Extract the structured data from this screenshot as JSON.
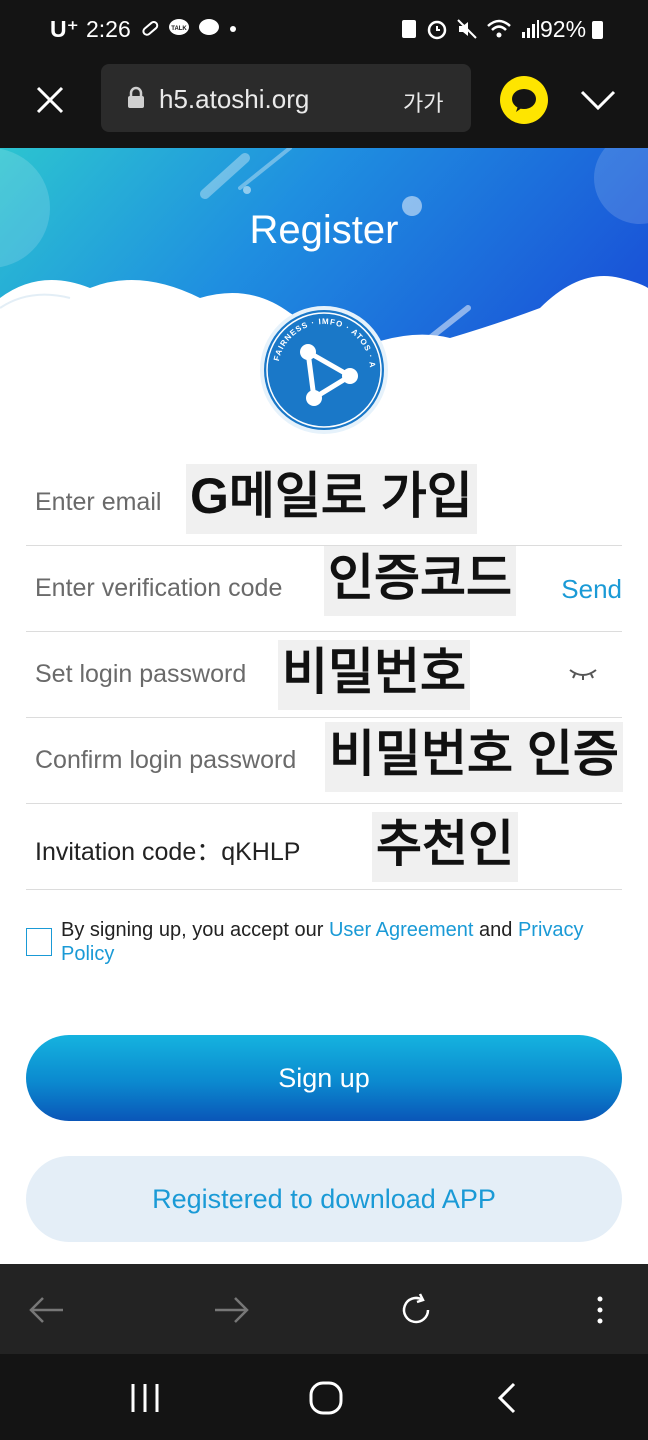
{
  "status_bar": {
    "carrier": "U⁺",
    "time": "2:26",
    "battery": "92%"
  },
  "browser": {
    "url": "h5.atoshi.org",
    "text_size_label": "가가"
  },
  "page": {
    "title": "Register",
    "logo_text": "FAIRNESS · IMFO · ATOS · ATOSHI"
  },
  "form": {
    "email": {
      "placeholder": "Enter email",
      "overlay": "G메일로 가입"
    },
    "verification": {
      "placeholder": "Enter verification code",
      "overlay": "인증코드",
      "send_label": "Send"
    },
    "password": {
      "placeholder": "Set login password",
      "overlay": "비밀번호"
    },
    "confirm_password": {
      "placeholder": "Confirm login password",
      "overlay": "비밀번호 인증"
    },
    "invitation": {
      "value": "Invitation code：qKHLP",
      "overlay": "추천인"
    }
  },
  "agreement": {
    "prefix": "By signing up, you accept our ",
    "user_agreement": "User Agreement",
    "and": " and ",
    "privacy_policy": "Privacy Policy"
  },
  "buttons": {
    "signup": "Sign up",
    "download": "Registered to download APP"
  },
  "colors": {
    "accent": "#1a9ad6",
    "status_bar_bg": "#141414",
    "kakao_yellow": "#fee500"
  }
}
